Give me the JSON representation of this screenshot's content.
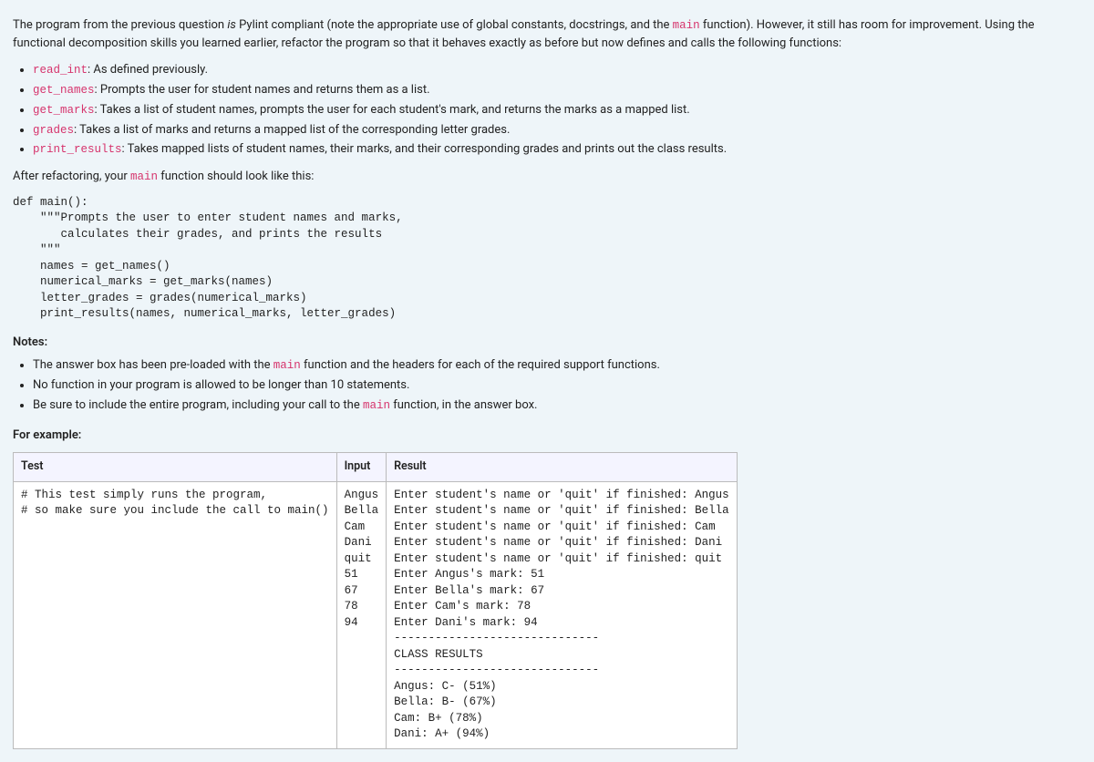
{
  "intro": {
    "para1_pre": "The program from the previous question ",
    "para1_italic": "is",
    "para1_post1": " Pylint compliant (note the appropriate use of global constants, docstrings, and the ",
    "para1_main": "main",
    "para1_post2": " function). However, it still has room for improvement. Using the functional decomposition skills you learned earlier, refactor the program so that it behaves exactly as before but now defines and calls the following functions:"
  },
  "func_list": [
    {
      "name": "read_int",
      "desc": ": As defined previously."
    },
    {
      "name": "get_names",
      "desc": ": Prompts the user for student names and returns them as a list."
    },
    {
      "name": "get_marks",
      "desc": ": Takes a list of student names, prompts the user for each student's mark, and returns the marks as a mapped list."
    },
    {
      "name": "grades",
      "desc": ": Takes a list of marks and returns a mapped list of the corresponding letter grades."
    },
    {
      "name": "print_results",
      "desc": ": Takes mapped lists of student names, their marks, and their corresponding grades and prints out the class results."
    }
  ],
  "after_refactor": {
    "pre": "After refactoring, your ",
    "main_code": "main",
    "post": " function should look like this:"
  },
  "code_block": "def main():\n    \"\"\"Prompts the user to enter student names and marks,\n       calculates their grades, and prints the results\n    \"\"\"\n    names = get_names()\n    numerical_marks = get_marks(names)\n    letter_grades = grades(numerical_marks)\n    print_results(names, numerical_marks, letter_grades)",
  "notes_heading": "Notes:",
  "notes": {
    "n1_pre": "The answer box has been pre-loaded with the ",
    "n1_main": "main",
    "n1_post": " function and the headers for each of the required support functions.",
    "n2": "No function in your program is allowed to be longer than 10 statements.",
    "n3_pre": "Be sure to include the entire program, including your call to the ",
    "n3_main": "main",
    "n3_post": " function, in the answer box."
  },
  "example_heading": "For example:",
  "table": {
    "headers": {
      "test": "Test",
      "input": "Input",
      "result": "Result"
    },
    "row": {
      "test": "# This test simply runs the program,\n# so make sure you include the call to main()",
      "input": "Angus\nBella\nCam\nDani\nquit\n51\n67\n78\n94",
      "result": "Enter student's name or 'quit' if finished: Angus\nEnter student's name or 'quit' if finished: Bella\nEnter student's name or 'quit' if finished: Cam\nEnter student's name or 'quit' if finished: Dani\nEnter student's name or 'quit' if finished: quit\nEnter Angus's mark: 51\nEnter Bella's mark: 67\nEnter Cam's mark: 78\nEnter Dani's mark: 94\n------------------------------\nCLASS RESULTS\n------------------------------\nAngus: C- (51%)\nBella: B- (67%)\nCam: B+ (78%)\nDani: A+ (94%)"
    }
  }
}
